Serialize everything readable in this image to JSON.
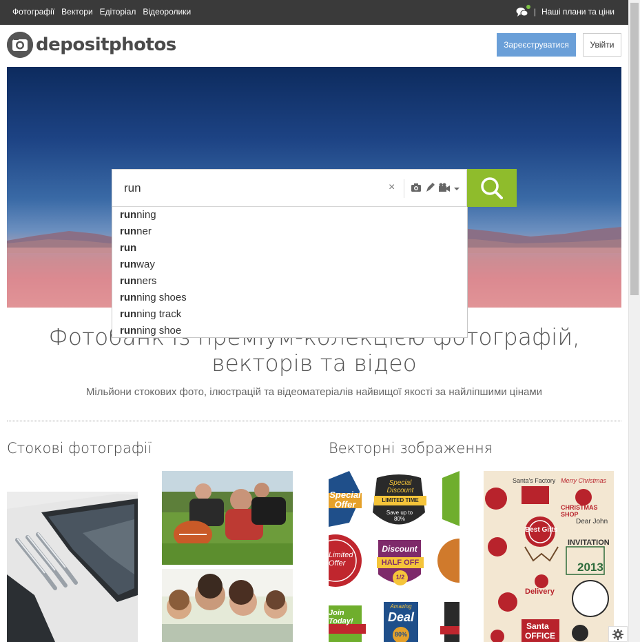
{
  "topbar": {
    "nav": [
      "Фотографії",
      "Вектори",
      "Едіторіал",
      "Відеоролики"
    ],
    "plans_link": "Наші плани та ціни",
    "separator": "|"
  },
  "header": {
    "logo_text": "depositphotos",
    "register_label": "Зареєструватися",
    "login_label": "Увійти"
  },
  "search": {
    "value": "run",
    "clear_symbol": "×",
    "suggestions": [
      {
        "bold": "run",
        "rest": "ning"
      },
      {
        "bold": "run",
        "rest": "ner"
      },
      {
        "bold": "run",
        "rest": ""
      },
      {
        "bold": "run",
        "rest": "way"
      },
      {
        "bold": "run",
        "rest": "ners"
      },
      {
        "bold": "run",
        "rest": "ning shoes"
      },
      {
        "bold": "run",
        "rest": "ning track"
      },
      {
        "bold": "run",
        "rest": "ning shoe"
      }
    ]
  },
  "main": {
    "headline": "Фотобанк із преміум-колекцією фотографій, векторів та відео",
    "subline": "Мільйони стокових фото, ілюстрацій та відеоматеріалів найвищої якості за найліпшими цінами",
    "section_photos": "Стокові фотографії",
    "section_vectors": "Векторні зображення"
  },
  "vector_badges": {
    "b1": "Special Offer",
    "b2_top": "Special Discount",
    "b2_band": "LIMITED TIME",
    "b2_bottom": "Save up to 80%",
    "b3": "Limited Offer",
    "b4_top": "Discount",
    "b4_band": "HALF OFF",
    "b4_bottom": "1/2",
    "b5": "Join Today!",
    "b6_top": "Amazing",
    "b6_mid": "Deal",
    "b6_bottom": "80%"
  },
  "christmas_art": {
    "t1": "Santa's Factory",
    "t2": "Merry Christmas",
    "t3": "CHRISTMAS SHOP",
    "t4": "Best Gifts",
    "t5": "Dear John",
    "t6": "INVITATION",
    "t7": "2013",
    "t8": "Delivery",
    "t9": "Santa",
    "t10": "OFFICE"
  },
  "colors": {
    "topbar": "#3a3a3a",
    "register_button": "#6a9fd8",
    "search_button": "#8fbc2c"
  }
}
